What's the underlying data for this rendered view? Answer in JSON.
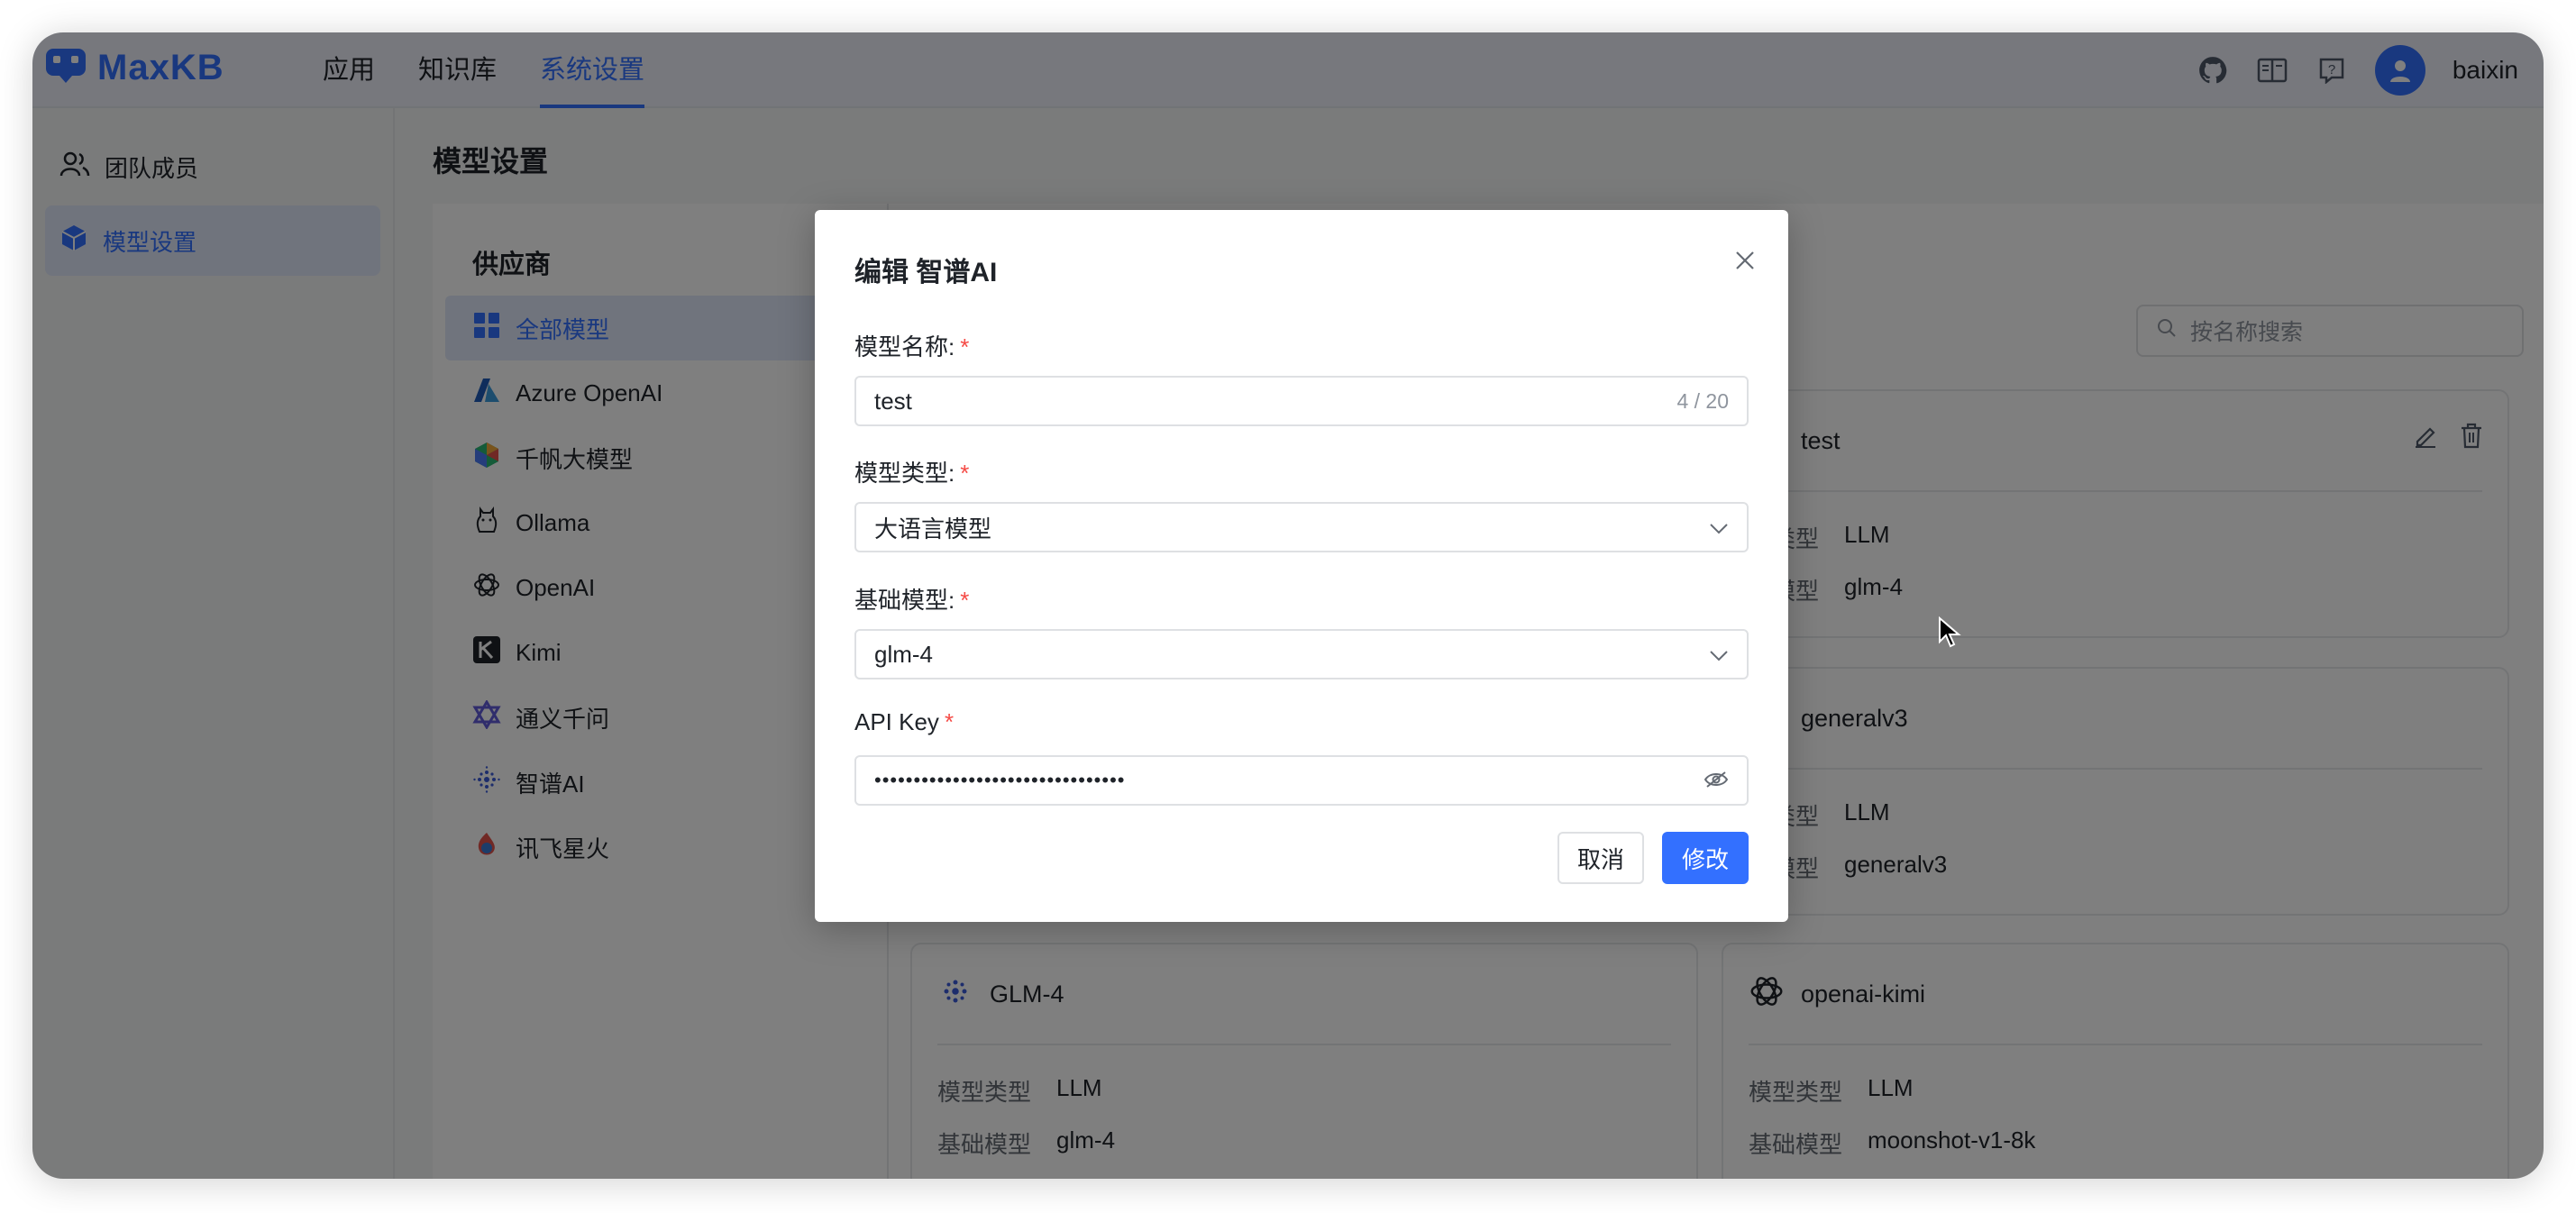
{
  "app": {
    "logo_text": "MaxKB",
    "username": "baixin"
  },
  "topnav": [
    {
      "label": "应用"
    },
    {
      "label": "知识库"
    },
    {
      "label": "系统设置",
      "active": true
    }
  ],
  "top_icons": [
    "github-icon",
    "book-icon",
    "help-icon"
  ],
  "sidebar": {
    "items": [
      {
        "label": "团队成员",
        "icon": "team-icon"
      },
      {
        "label": "模型设置",
        "icon": "cube-icon",
        "active": true
      }
    ]
  },
  "main": {
    "title": "模型设置",
    "providers_title": "供应商",
    "providers": [
      {
        "label": "全部模型",
        "icon": "grid-icon",
        "active": true
      },
      {
        "label": "Azure OpenAI",
        "icon": "azure-icon"
      },
      {
        "label": "千帆大模型",
        "icon": "qianfan-icon"
      },
      {
        "label": "Ollama",
        "icon": "ollama-icon"
      },
      {
        "label": "OpenAI",
        "icon": "openai-icon"
      },
      {
        "label": "Kimi",
        "icon": "kimi-icon"
      },
      {
        "label": "通义千问",
        "icon": "tongyi-icon"
      },
      {
        "label": "智谱AI",
        "icon": "zhipu-icon"
      },
      {
        "label": "讯飞星火",
        "icon": "xunfei-icon"
      }
    ],
    "search_placeholder": "按名称搜索",
    "cards": [
      {
        "name": "test",
        "type_label": "型类型",
        "type": "LLM",
        "base_label": "础模型",
        "base": "glm-4"
      },
      {
        "name": "generalv3",
        "type_label": "型类型",
        "type": "LLM",
        "base_label": "础模型",
        "base": "generalv3"
      },
      {
        "name": "GLM-4",
        "type_label": "模型类型",
        "type": "LLM",
        "base_label": "基础模型",
        "base": "glm-4"
      },
      {
        "name": "openai-kimi",
        "type_label": "模型类型",
        "type": "LLM",
        "base_label": "基础模型",
        "base": "moonshot-v1-8k"
      }
    ]
  },
  "dialog": {
    "title": "编辑 智谱AI",
    "name_label": "模型名称:",
    "name_value": "test",
    "name_counter": "4 / 20",
    "type_label": "模型类型:",
    "type_value": "大语言模型",
    "base_label": "基础模型:",
    "base_value": "glm-4",
    "apikey_label": "API Key",
    "apikey_value": "••••••••••••••••••••••••••••••••",
    "required_mark": "*",
    "cancel_label": "取消",
    "submit_label": "修改"
  },
  "colors": {
    "accent": "#3370ff",
    "required": "#f54a45"
  }
}
